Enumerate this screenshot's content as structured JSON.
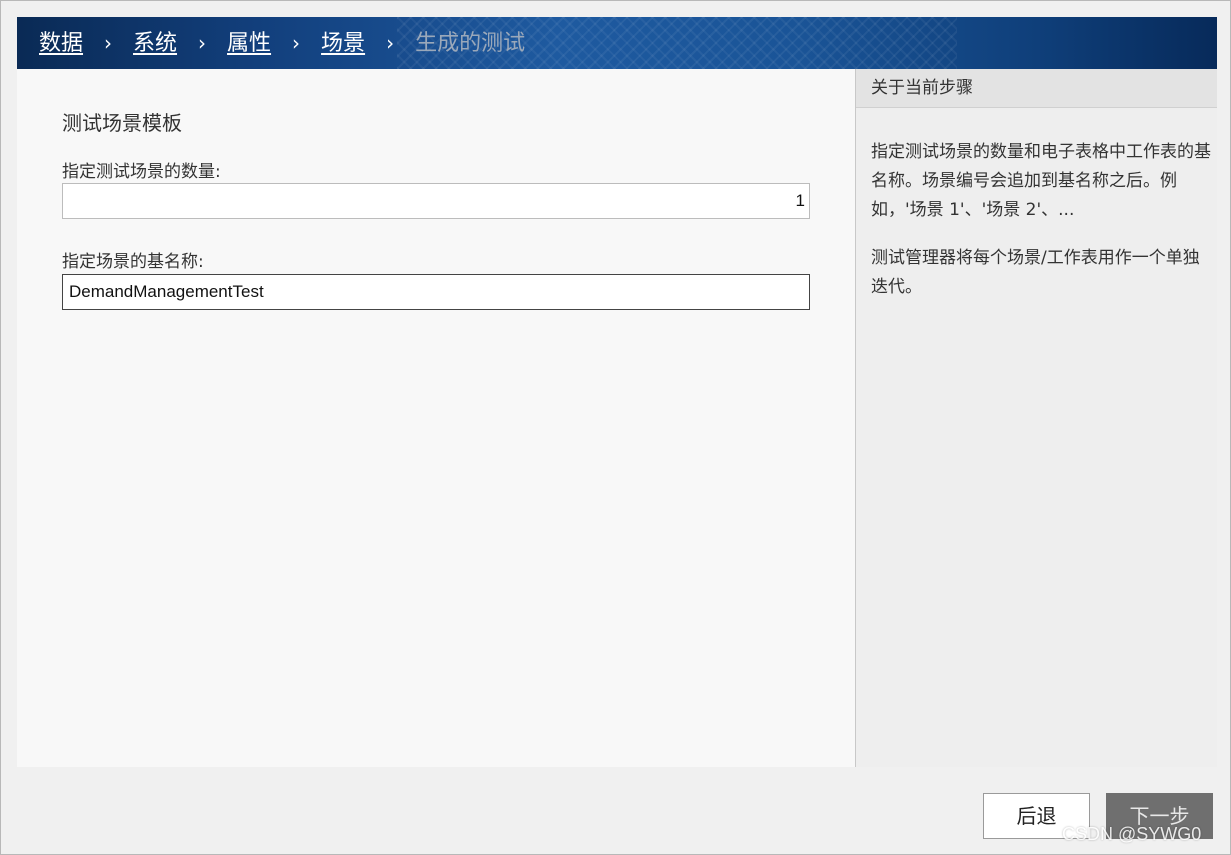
{
  "breadcrumb": {
    "items": [
      {
        "label": "数据"
      },
      {
        "label": "系统"
      },
      {
        "label": "属性"
      },
      {
        "label": "场景"
      },
      {
        "label": "生成的测试"
      }
    ],
    "separator": "›"
  },
  "main": {
    "section_title": "测试场景模板",
    "count_label": "指定测试场景的数量:",
    "count_value": "1",
    "name_label": "指定场景的基名称:",
    "name_value": "DemandManagementTest"
  },
  "side_panel": {
    "title": "关于当前步骤",
    "paragraph1": "指定测试场景的数量和电子表格中工作表的基名称。场景编号会追加到基名称之后。例如，'场景 1'、'场景 2'、...",
    "paragraph2": "测试管理器将每个场景/工作表用作一个单独迭代。"
  },
  "footer": {
    "back_label": "后退",
    "next_label": "下一步"
  },
  "watermark": "CSDN @SYWG0",
  "colors": {
    "header_dark": "#0a2a55",
    "header_mid": "#1e5aa0",
    "next_button": "#6f6f6f"
  }
}
